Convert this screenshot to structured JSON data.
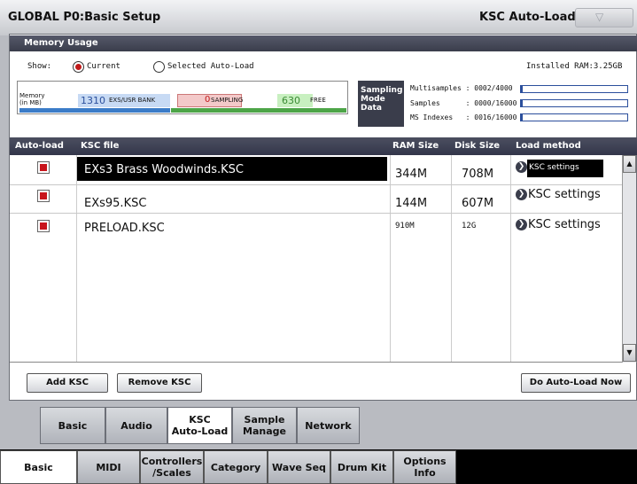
{
  "header": {
    "title": "GLOBAL P0:Basic Setup",
    "page_name": "KSC Auto-Load",
    "menu_glyph": "▽"
  },
  "memory": {
    "section_title": "Memory Usage",
    "show_label": "Show:",
    "radio_current": "Current",
    "radio_selected": "Selected Auto-Load",
    "installed_ram": "Installed RAM:3.25GB",
    "memory_label_1": "Memory",
    "memory_label_2": "(in MB)",
    "exs_value": "1310",
    "exs_label": "EXS/USR BANK",
    "sampling_value": "0",
    "sampling_label": "SAMPLING",
    "free_value": "630",
    "free_label": "FREE",
    "smd_label_1": "Sampling",
    "smd_label_2": "Mode",
    "smd_label_3": "Data",
    "multisamples": "Multisamples : 0002/4000",
    "samples": "Samples      : 0000/16000",
    "ms_indexes": "MS Indexes   : 0016/16000",
    "gauge_levels": [
      0.0005,
      0.0,
      0.001
    ]
  },
  "table": {
    "headers": {
      "auto_load": "Auto-load",
      "ksc_file": "KSC file",
      "ram": "RAM Size",
      "disk": "Disk Size",
      "method": "Load method"
    },
    "rows": [
      {
        "file": "EXs3 Brass Woodwinds.KSC",
        "ram": "344M",
        "disk": "708M",
        "method": "KSC settings",
        "checked": true
      },
      {
        "file": "EXs95.KSC",
        "ram": "144M",
        "disk": "607M",
        "method": "KSC settings",
        "checked": true
      },
      {
        "file": "PRELOAD.KSC",
        "ram": "910M",
        "disk": "12G",
        "method": "KSC settings",
        "checked": true
      }
    ]
  },
  "buttons": {
    "add": "Add KSC",
    "remove": "Remove KSC",
    "auto_load_now": "Do Auto-Load Now"
  },
  "tabs": {
    "basic": "Basic",
    "audio": "Audio",
    "ksc_1": "KSC",
    "ksc_2": "Auto-Load",
    "sample_1": "Sample",
    "sample_2": "Manage",
    "network": "Network"
  },
  "bottom_tabs": {
    "basic": "Basic",
    "midi": "MIDI",
    "controllers_1": "Controllers",
    "controllers_2": "/Scales",
    "category": "Category",
    "wave_seq": "Wave Seq",
    "drum_kit": "Drum Kit",
    "options_1": "Options",
    "options_2": "Info"
  },
  "colors": {
    "accent_red": "#c8141c",
    "header_dark": "#3a3d4b"
  }
}
